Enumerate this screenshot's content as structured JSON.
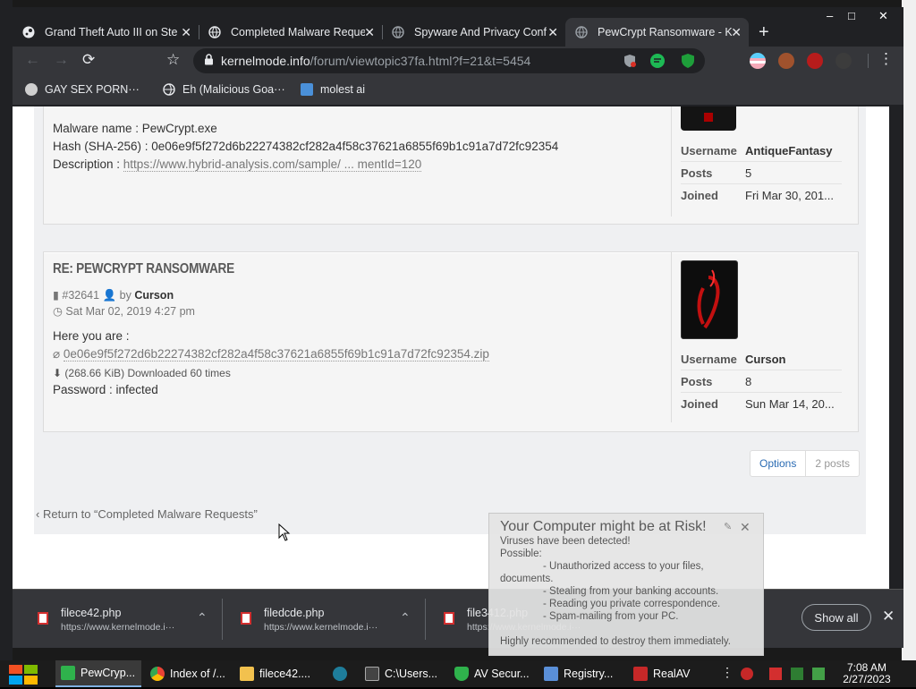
{
  "browser": {
    "tabs": [
      {
        "title": "Grand Theft Auto III on Ste",
        "icon": "steam-icon"
      },
      {
        "title": "Completed Malware Reque",
        "icon": "globe-icon"
      },
      {
        "title": "Spyware And Privacy Conf",
        "icon": "globe-icon"
      },
      {
        "title": "PewCrypt Ransomware - K",
        "icon": "globe-icon",
        "active": true
      }
    ],
    "new_tab": "+",
    "window": {
      "minimize": "–",
      "maximize": "□",
      "close": "✕"
    },
    "nav": {
      "back": "←",
      "forward": "→",
      "reload": "⟳",
      "bookmark": "☆"
    },
    "url_host": "kernelmode.info",
    "url_path": "/forum/viewtopic37fa.html?f=21&t=5454",
    "menu": "⋮"
  },
  "bookmarks": [
    {
      "label": "GAY SEX PORN···"
    },
    {
      "label": "Eh (Malicious Goa···"
    },
    {
      "label": "molest ai"
    }
  ],
  "post1": {
    "malware_name": "Malware name : PewCrypt.exe",
    "hash": "Hash (SHA-256) : 0e06e9f5f272d6b22274382cf282a4f58c37621a6855f69b1c91a7d72fc92354",
    "description_label": "Description :",
    "description_link": "https://www.hybrid-analysis.com/sample/ ... mentId=120",
    "profile": {
      "username_label": "Username",
      "username": "AntiqueFantasy",
      "posts_label": "Posts",
      "posts": "5",
      "joined_label": "Joined",
      "joined": "Fri Mar 30, 201..."
    }
  },
  "post2": {
    "title": "Re: PewCrypt Ransomware",
    "post_id": "#32641",
    "by": "by",
    "author": "Curson",
    "date": "Sat Mar 02, 2019 4:27 pm",
    "text": "Here you are :",
    "attachment": "0e06e9f5f272d6b22274382cf282a4f58c37621a6855f69b1c91a7d72fc92354.zip",
    "attachment_info": "(268.66 KiB) Downloaded 60 times",
    "password": "Password : infected",
    "profile": {
      "username_label": "Username",
      "username": "Curson",
      "posts_label": "Posts",
      "posts": "8",
      "joined_label": "Joined",
      "joined": "Sun Mar 14, 20..."
    }
  },
  "topic_actions": {
    "options": "Options",
    "count": "2 posts"
  },
  "return_link": "Return to “Completed Malware Requests”",
  "downloads": [
    {
      "name": "filece42.php",
      "url": "https://www.kernelmode.i···"
    },
    {
      "name": "filedcde.php",
      "url": "https://www.kernelmode.i···"
    },
    {
      "name": "file3412.php",
      "url": "https://www.kernelmode.i···"
    }
  ],
  "download_bar": {
    "show_all": "Show all",
    "close": "✕"
  },
  "popup": {
    "title": "Your Computer might  be at Risk!",
    "lines": [
      "Viruses have been detected!",
      "Possible:",
      "- Unauthorized access to your files,",
      "documents.",
      "- Stealing from your banking accounts.",
      "- Reading you private correspondence.",
      "- Spam-mailing from your PC.",
      "Highly recommended to destroy them immediately."
    ],
    "close": "✕"
  },
  "taskbar": {
    "items": [
      {
        "label": "PewCryp...",
        "color": "#2fb24c"
      },
      {
        "label": "Index of /...",
        "color": "#f4b400"
      },
      {
        "label": "filece42....",
        "color": "#f2c14e"
      },
      {
        "label": "",
        "color": "#1e7d9b"
      },
      {
        "label": "C:\\Users...",
        "color": "#444444"
      },
      {
        "label": "AV Secur...",
        "color": "#2fb24c"
      },
      {
        "label": "Registry...",
        "color": "#5a8fd8"
      },
      {
        "label": "RealAV",
        "color": "#c62828"
      }
    ],
    "time": "7:08 AM",
    "date": "2/27/2023"
  }
}
